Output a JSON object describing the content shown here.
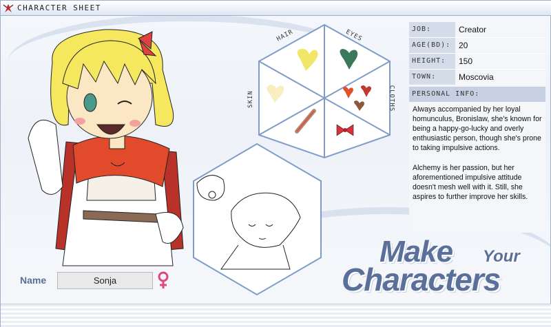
{
  "window": {
    "title": "CHARACTER SHEET",
    "icon": "winged-emblem-icon"
  },
  "character": {
    "name_label": "Name",
    "name": "Sonja",
    "gender_icon": "female-symbol-icon",
    "gender_color": "#e0477a"
  },
  "palette": {
    "labels": {
      "hair": "HAIR",
      "eyes": "EYES",
      "cloths": "CLOTHS",
      "skin": "SKIN"
    },
    "hair_color": "#f2e66a",
    "eyes_color": "#3a7a5a",
    "skin_color": "#f8efc0",
    "cloths_colors": [
      "#e0502a",
      "#c03830",
      "#8a5a3a"
    ]
  },
  "info": {
    "job_label": "JOB:",
    "job": "Creator",
    "age_label": "AGE(BD):",
    "age": "20",
    "height_label": "HEIGHT:",
    "height": "150",
    "town_label": "TOWN:",
    "town": "Moscovia",
    "personal_label": "PERSONAL INFO:",
    "personal_p1": "Always accompanied by her loyal homunculus, Bronislaw, she's known for being a happy-go-lucky and overly enthusiastic person, though she's prone to taking impulsive actions.",
    "personal_p2": "Alchemy is her passion, but her aforementioned impulsive attitude doesn't mesh well with it. Still, she aspires to further improve her skills."
  },
  "logo": {
    "line1": "Make",
    "line2": "Your",
    "line3": "Characters"
  }
}
